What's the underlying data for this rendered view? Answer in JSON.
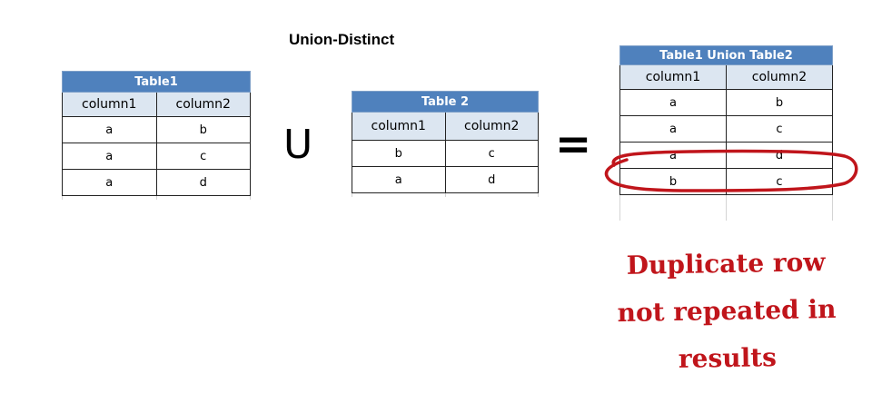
{
  "title": "Union-Distinct",
  "operators": {
    "union": "U",
    "equals": "="
  },
  "table1": {
    "name": "Table1",
    "columns": [
      "column1",
      "column2"
    ],
    "rows": [
      [
        "a",
        "b"
      ],
      [
        "a",
        "c"
      ],
      [
        "a",
        "d"
      ]
    ]
  },
  "table2": {
    "name": "Table 2",
    "columns": [
      "column1",
      "column2"
    ],
    "rows": [
      [
        "b",
        "c"
      ],
      [
        "a",
        "d"
      ]
    ]
  },
  "result": {
    "name": "Table1 Union Table2",
    "columns": [
      "column1",
      "column2"
    ],
    "rows": [
      [
        "a",
        "b"
      ],
      [
        "a",
        "c"
      ],
      [
        "a",
        "d"
      ],
      [
        "b",
        "c"
      ]
    ]
  },
  "annotation": {
    "line1": "Duplicate row",
    "line2": "not repeated in",
    "line3": "results"
  },
  "colors": {
    "header": "#4f81bd",
    "column_header": "#dce6f1",
    "highlight": "#c0151b"
  }
}
